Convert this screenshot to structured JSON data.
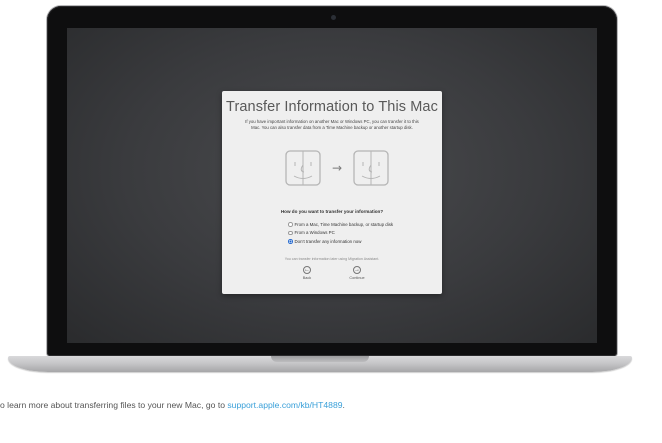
{
  "dialog": {
    "title": "Transfer Information to This Mac",
    "subtitle": "If you have important information on another Mac or Windows PC, you can transfer it to this Mac. You can also transfer data from a Time Machine backup or another startup disk.",
    "question": "How do you want to transfer your information?",
    "options": [
      {
        "label": "From a Mac, Time Machine backup, or startup disk",
        "selected": false
      },
      {
        "label": "From a Windows PC",
        "selected": false
      },
      {
        "label": "Don’t transfer any information now",
        "selected": true
      }
    ],
    "hint": "You can transfer information later using Migration Assistant.",
    "back_label": "Back",
    "continue_label": "Continue",
    "back_glyph": "←",
    "continue_glyph": "→",
    "arrow_glyph": "→"
  },
  "footer": {
    "text": "o learn more about transferring files to your new Mac, go to ",
    "link": "support.apple.com/kb/HT4889",
    "end": "."
  },
  "colors": {
    "link": "#3aa0d9",
    "selected_radio": "#1f5fc4",
    "screen_bg": "#3a3b3e"
  }
}
